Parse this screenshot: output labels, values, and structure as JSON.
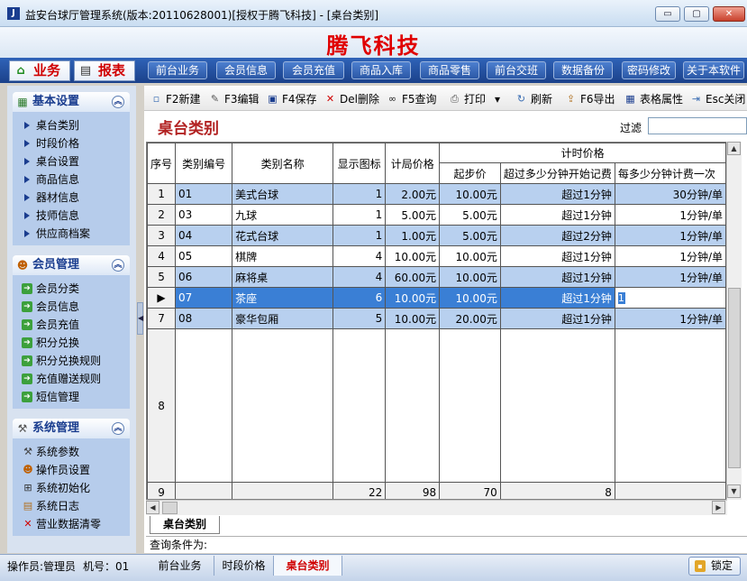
{
  "window": {
    "title": "益安台球厅管理系统(版本:20110628001)[授权于腾飞科技] - [桌台类别]",
    "app_icon": "J",
    "brand": "腾飞科技",
    "buttons": {
      "minimize": "▭",
      "maximize": "▢",
      "close": "✕"
    }
  },
  "top_menu": {
    "big_tabs": [
      {
        "label": "业务",
        "icon": "home-icon"
      },
      {
        "label": "报表",
        "icon": "report-icon"
      }
    ],
    "buttons": [
      "前台业务",
      "会员信息",
      "会员充值",
      "商品入库",
      "商品零售",
      "前台交班",
      "数据备份",
      "密码修改",
      "关于本软件"
    ]
  },
  "sidebar": {
    "groups": [
      {
        "title": "基本设置",
        "items": [
          "桌台类别",
          "时段价格",
          "桌台设置",
          "商品信息",
          "器材信息",
          "技师信息",
          "供应商档案"
        ]
      },
      {
        "title": "会员管理",
        "items": [
          "会员分类",
          "会员信息",
          "会员充值",
          "积分兑换",
          "积分兑换规则",
          "充值赠送规则",
          "短信管理"
        ]
      },
      {
        "title": "系统管理",
        "items": [
          "系统参数",
          "操作员设置",
          "系统初始化",
          "系统日志",
          "营业数据清零"
        ]
      }
    ]
  },
  "toolbar": {
    "new": "F2新建",
    "edit": "F3编辑",
    "save": "F4保存",
    "delete": "Del删除",
    "query": "F5查询",
    "print": "打印",
    "refresh": "刷新",
    "export": "F6导出",
    "table_props": "表格属性",
    "close": "Esc关闭"
  },
  "page": {
    "title": "桌台类别",
    "filter_label": "过滤",
    "filter_value": ""
  },
  "grid": {
    "headers": {
      "seq": "序号",
      "code": "类别编号",
      "name": "类别名称",
      "icon": "显示图标",
      "price": "计局价格",
      "timed": "计时价格",
      "start": "起步价",
      "over": "超过多少分钟开始记费",
      "every": "每多少分钟计费一次"
    },
    "rows": [
      {
        "seq": "1",
        "code": "01",
        "name": "美式台球",
        "icon": "1",
        "price": "2.00元",
        "start": "10.00元",
        "over": "超过1分钟",
        "every": "30分钟/单"
      },
      {
        "seq": "2",
        "code": "03",
        "name": "九球",
        "icon": "1",
        "price": "5.00元",
        "start": "5.00元",
        "over": "超过1分钟",
        "every": "1分钟/单"
      },
      {
        "seq": "3",
        "code": "04",
        "name": "花式台球",
        "icon": "1",
        "price": "1.00元",
        "start": "5.00元",
        "over": "超过2分钟",
        "every": "1分钟/单"
      },
      {
        "seq": "4",
        "code": "05",
        "name": "棋牌",
        "icon": "4",
        "price": "10.00元",
        "start": "10.00元",
        "over": "超过1分钟",
        "every": "1分钟/单"
      },
      {
        "seq": "5",
        "code": "06",
        "name": "麻将桌",
        "icon": "4",
        "price": "60.00元",
        "start": "10.00元",
        "over": "超过1分钟",
        "every": "1分钟/单"
      },
      {
        "seq": "6",
        "code": "07",
        "name": "茶座",
        "icon": "6",
        "price": "10.00元",
        "start": "10.00元",
        "over": "超过1分钟",
        "every": "1"
      },
      {
        "seq": "7",
        "code": "08",
        "name": "豪华包厢",
        "icon": "5",
        "price": "10.00元",
        "start": "20.00元",
        "over": "超过1分钟",
        "every": "1分钟/单"
      }
    ],
    "empty_row_seq": "8",
    "footer": {
      "seq": "9",
      "icon": "22",
      "price": "98",
      "start": "70",
      "over": "8"
    },
    "selected_row_marker": "▶"
  },
  "grid_tab": "桌台类别",
  "query_line": "查询条件为:",
  "status": {
    "operator": "操作员:管理员",
    "machine": "机号：01",
    "tabs": [
      "前台业务",
      "时段价格",
      "桌台类别"
    ],
    "active_tab": "桌台类别",
    "lock": "锁定"
  }
}
